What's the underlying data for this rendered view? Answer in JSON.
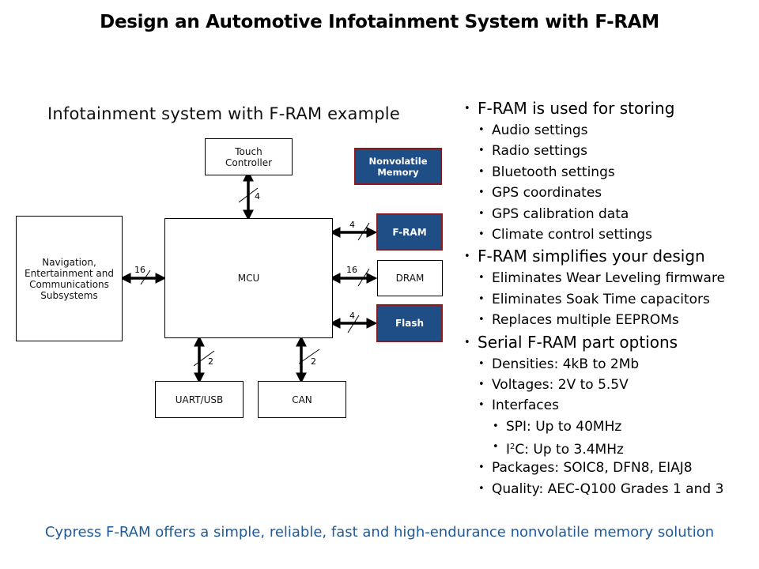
{
  "slide": {
    "title": "Design an Automotive Infotainment System with F-RAM",
    "footer": "Cypress F-RAM offers a simple, reliable, fast and high-endurance nonvolatile memory solution"
  },
  "diagram": {
    "subtitle": "Infotainment system with F-RAM example",
    "colors": {
      "nonvolatile_fill": "#1f4e87",
      "nonvolatile_border": "#8b1a1a"
    },
    "blocks": {
      "touch": "Touch\nController",
      "nav": "Navigation,\nEntertainment and\nCommunications\nSubsystems",
      "mcu": "MCU",
      "legend": "Nonvolatile\nMemory",
      "fram": "F-RAM",
      "dram": "DRAM",
      "flash": "Flash",
      "uart": "UART/USB",
      "can": "CAN"
    },
    "buses": {
      "touch": "4",
      "nav": "16",
      "fram": "4",
      "dram": "16",
      "flash": "4",
      "uart": "2",
      "can": "2"
    }
  },
  "bullets": [
    {
      "level": 1,
      "text": "F-RAM is used for storing"
    },
    {
      "level": 2,
      "text": "Audio settings"
    },
    {
      "level": 2,
      "text": "Radio settings"
    },
    {
      "level": 2,
      "text": "Bluetooth settings"
    },
    {
      "level": 2,
      "text": "GPS coordinates"
    },
    {
      "level": 2,
      "text": "GPS calibration data"
    },
    {
      "level": 2,
      "text": "Climate control settings"
    },
    {
      "level": 1,
      "text": "F-RAM simplifies your design"
    },
    {
      "level": 2,
      "text": "Eliminates Wear Leveling firmware"
    },
    {
      "level": 2,
      "text": "Eliminates Soak Time capacitors"
    },
    {
      "level": 2,
      "text": "Replaces multiple EEPROMs"
    },
    {
      "level": 1,
      "text": "Serial F-RAM part options"
    },
    {
      "level": 2,
      "text": "Densities: 4kB to 2Mb"
    },
    {
      "level": 2,
      "text": "Voltages: 2V to 5.5V"
    },
    {
      "level": 2,
      "text": "Interfaces"
    },
    {
      "level": 3,
      "text": "SPI: Up to 40MHz"
    },
    {
      "level": 3,
      "text": "I",
      "sup": "2",
      "after": "C: Up to 3.4MHz"
    },
    {
      "level": 2,
      "text": "Packages: SOIC8, DFN8, EIAJ8"
    },
    {
      "level": 2,
      "text": "Quality: AEC-Q100 Grades 1 and 3"
    }
  ]
}
